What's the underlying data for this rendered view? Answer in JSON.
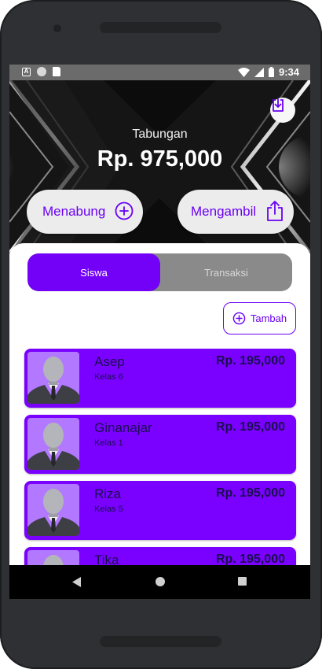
{
  "status_bar": {
    "time": "9:34",
    "notification_icons": [
      "a-icon",
      "circle-icon",
      "sd-card-icon"
    ],
    "system_icons": [
      "wifi-icon",
      "signal-icon",
      "battery-icon"
    ]
  },
  "header": {
    "title": "Tabungan",
    "total_amount": "Rp. 975,000",
    "download_icon": "download-icon"
  },
  "actions": {
    "menabung_label": "Menabung",
    "menabung_icon": "plus-circle-icon",
    "mengambil_label": "Mengambil",
    "mengambil_icon": "share-upload-icon"
  },
  "tabs": [
    {
      "label": "Siswa",
      "selected": true
    },
    {
      "label": "Transaksi",
      "selected": false
    }
  ],
  "add_button": {
    "label": "Tambah",
    "icon": "plus-circle-icon"
  },
  "students": [
    {
      "name": "Asep",
      "class": "Kelas 6",
      "amount": "Rp. 195,000"
    },
    {
      "name": "Ginanajar",
      "class": "Kelas 1",
      "amount": "Rp. 195,000"
    },
    {
      "name": "Riza",
      "class": "Kelas 5",
      "amount": "Rp. 195,000"
    },
    {
      "name": "Tika",
      "class": "",
      "amount": "Rp. 195,000"
    }
  ],
  "colors": {
    "accent": "#7300f7",
    "card": "#7a00ff",
    "header_bg": "#121212",
    "tab_inactive": "#8a8a8a"
  },
  "nav_icons": [
    "back-icon",
    "home-icon",
    "recents-icon"
  ]
}
